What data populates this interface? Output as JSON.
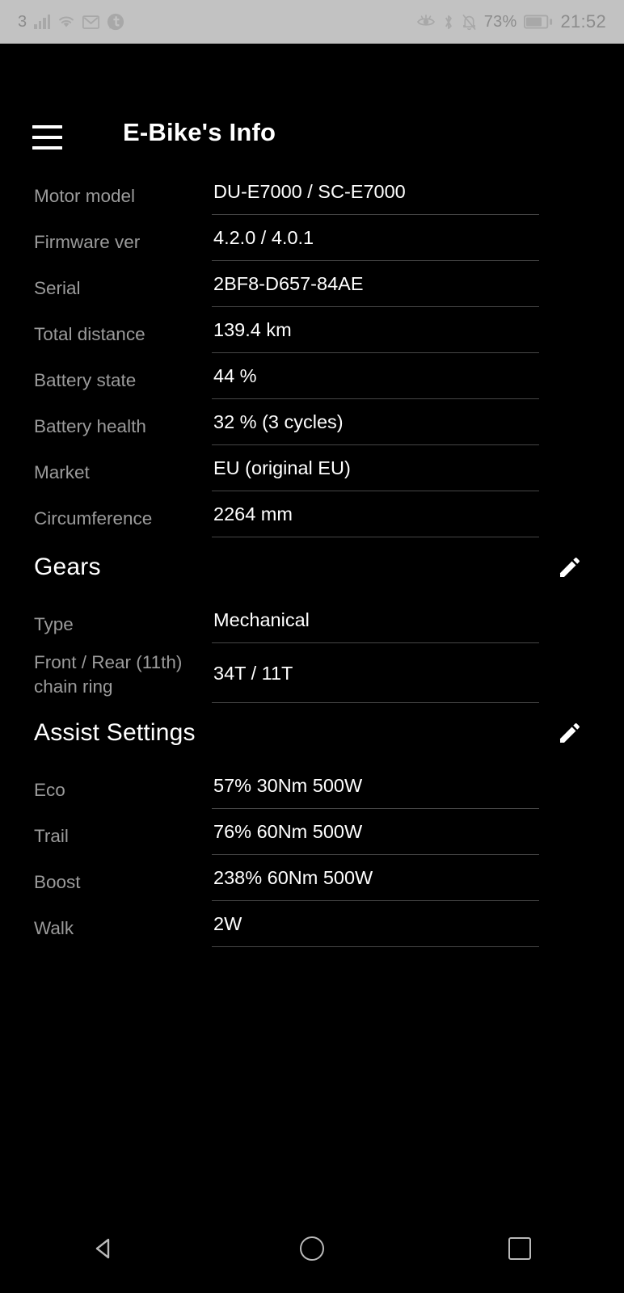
{
  "status_bar": {
    "sim_label": "3",
    "battery_percent": "73%",
    "time": "21:52",
    "icons": [
      "signal-bars-icon",
      "wifi-icon",
      "gmail-icon",
      "tumblr-icon",
      "eye-comfort-icon",
      "bluetooth-icon",
      "notifications-muted-icon",
      "battery-icon"
    ]
  },
  "app_bar": {
    "menu_icon": "hamburger-menu-icon",
    "title": "E-Bike's Info"
  },
  "info": {
    "rows": [
      {
        "label": "Motor model",
        "value": "DU-E7000 / SC-E7000"
      },
      {
        "label": "Firmware ver",
        "value": "4.2.0 / 4.0.1"
      },
      {
        "label": "Serial",
        "value": "2BF8-D657-84AE"
      },
      {
        "label": "Total distance",
        "value": "139.4 km"
      },
      {
        "label": "Battery state",
        "value": "44 %"
      },
      {
        "label": "Battery health",
        "value": "32 % (3 cycles)"
      },
      {
        "label": "Market",
        "value": "EU (original EU)"
      },
      {
        "label": "Circumference",
        "value": "2264 mm"
      }
    ]
  },
  "gears": {
    "heading": "Gears",
    "edit_icon": "pencil-edit-icon",
    "rows": [
      {
        "label": "Type",
        "value": "Mechanical"
      },
      {
        "label": "Front / Rear (11th) chain ring",
        "value": "34T / 11T"
      }
    ]
  },
  "assist_settings": {
    "heading": "Assist Settings",
    "edit_icon": "pencil-edit-icon",
    "rows": [
      {
        "label": "Eco",
        "value": "57% 30Nm 500W"
      },
      {
        "label": "Trail",
        "value": "76% 60Nm 500W"
      },
      {
        "label": "Boost",
        "value": "238% 60Nm 500W"
      },
      {
        "label": "Walk",
        "value": "2W"
      }
    ]
  },
  "nav_bar": {
    "back": "back-nav-icon",
    "home": "home-nav-icon",
    "recents": "recents-nav-icon"
  },
  "colors": {
    "background": "#000000",
    "status_bar_bg": "#c2c2c2",
    "label_text": "#9b9b9b",
    "value_text": "#ffffff",
    "divider": "#474747"
  }
}
